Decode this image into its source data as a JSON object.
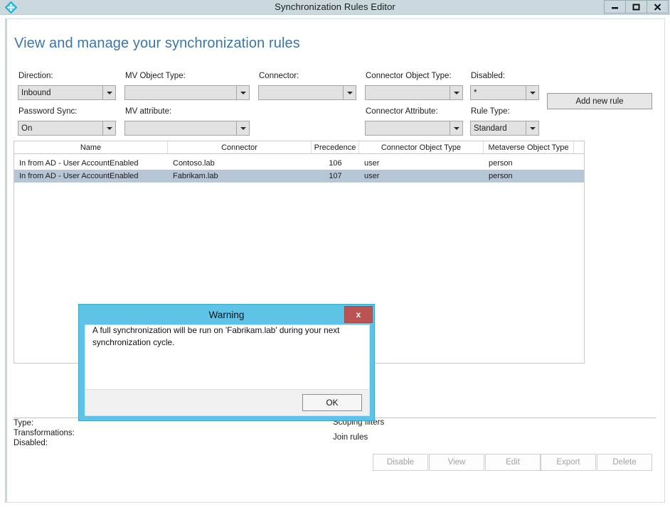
{
  "window": {
    "title": "Synchronization Rules Editor",
    "icon": "sync-diamond-icon",
    "controls": {
      "minimize": "minimize-icon",
      "maximize": "maximize-icon",
      "close": "close-icon"
    }
  },
  "page": {
    "heading": "View and manage your synchronization rules"
  },
  "filters": [
    {
      "label": "Direction:",
      "value": "Inbound",
      "name": "direction"
    },
    {
      "label": "MV Object Type:",
      "value": "",
      "name": "mv-object-type"
    },
    {
      "label": "Connector:",
      "value": "",
      "name": "connector"
    },
    {
      "label": "Connector Object Type:",
      "value": "",
      "name": "connector-object-type"
    },
    {
      "label": "Disabled:",
      "value": "*",
      "name": "disabled"
    },
    {
      "label": "Password Sync:",
      "value": "On",
      "name": "password-sync"
    },
    {
      "label": "MV attribute:",
      "value": "",
      "name": "mv-attribute"
    },
    {
      "label": "Connector Attribute:",
      "value": "",
      "name": "connector-attribute"
    },
    {
      "label": "Rule Type:",
      "value": "Standard",
      "name": "rule-type"
    }
  ],
  "toolbar": {
    "add_new_rule": "Add new rule"
  },
  "grid": {
    "columns": [
      "Name",
      "Connector",
      "Precedence",
      "Connector Object Type",
      "Metaverse Object Type"
    ],
    "rows": [
      {
        "name": "In from AD - User AccountEnabled",
        "connector": "Contoso.lab",
        "precedence": "106",
        "connector_object_type": "user",
        "metaverse_object_type": "person",
        "selected": false
      },
      {
        "name": "In from AD - User AccountEnabled",
        "connector": "Fabrikam.lab",
        "precedence": "107",
        "connector_object_type": "user",
        "metaverse_object_type": "person",
        "selected": true
      }
    ]
  },
  "details": {
    "type_label": "Type:",
    "type_value": "",
    "transformations_label": "Transformations:",
    "transformations_value": "",
    "disabled_label": "Disabled:",
    "disabled_value": "",
    "scoping_filters": "Scoping filters",
    "join_rules": "Join rules"
  },
  "actions": [
    {
      "label": "Disable",
      "name": "disable"
    },
    {
      "label": "View",
      "name": "view"
    },
    {
      "label": "Edit",
      "name": "edit"
    },
    {
      "label": "Export",
      "name": "export"
    },
    {
      "label": "Delete",
      "name": "delete"
    }
  ],
  "dialog": {
    "title": "Warning",
    "close_label": "x",
    "message": "A full synchronization will be run on 'Fabrikam.lab' during your next synchronization cycle.",
    "ok_label": "OK"
  },
  "colors": {
    "titlebar": "#cbd9df",
    "heading": "#3a76ab",
    "dialog_border": "#5ec3e6",
    "dialog_close": "#b95452",
    "selected_row": "#b6c6d6"
  }
}
